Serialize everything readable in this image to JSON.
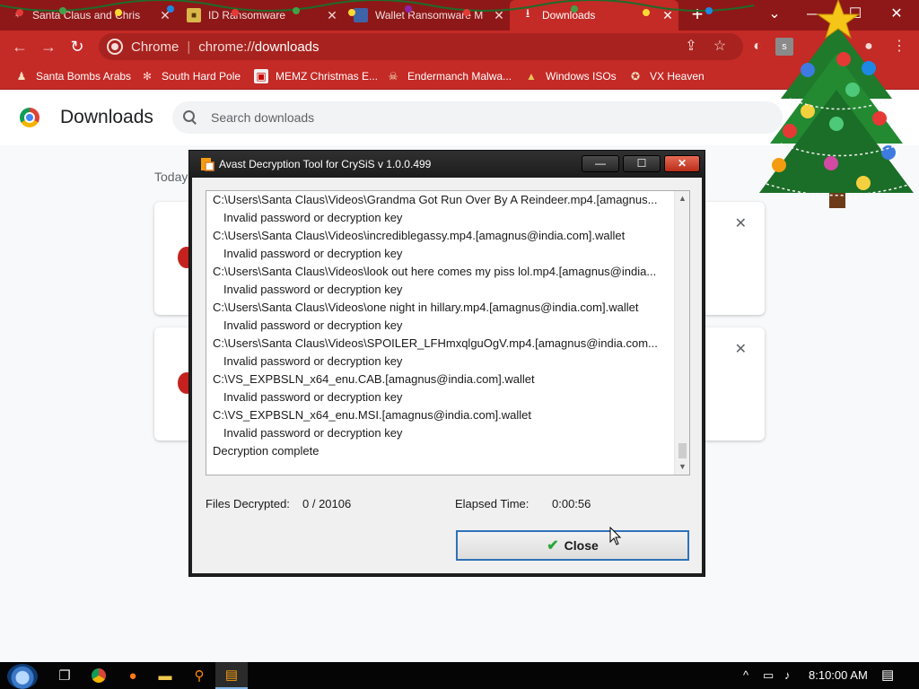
{
  "browser": {
    "tabs": [
      {
        "title": "Santa Claus and Chris",
        "favicon": "santa-icon",
        "active": false
      },
      {
        "title": "ID Ransomware",
        "favicon": "lock-icon",
        "active": false
      },
      {
        "title": "Wallet Ransomware M",
        "favicon": "window-icon",
        "active": false
      },
      {
        "title": "Downloads",
        "favicon": "download-icon",
        "active": true
      }
    ],
    "new_tab_label": "+",
    "omnibox": {
      "chip": "Chrome",
      "url_scheme": "chrome://",
      "url_path": "downloads"
    },
    "bookmarks": [
      {
        "label": "Santa Bombs Arabs",
        "icon": "santa-icon"
      },
      {
        "label": "South Hard Pole",
        "icon": "snowflake-icon"
      },
      {
        "label": "MEMZ Christmas E...",
        "icon": "window-icon"
      },
      {
        "label": "Endermanch Malwa...",
        "icon": "skull-icon"
      },
      {
        "label": "Windows ISOs",
        "icon": "tree-icon"
      },
      {
        "label": "VX Heaven",
        "icon": "wolf-icon"
      }
    ]
  },
  "downloads_page": {
    "title": "Downloads",
    "search_placeholder": "Search downloads",
    "section_label": "Today",
    "remove_glyph": "✕"
  },
  "dialog": {
    "title": "Avast Decryption Tool for CrySiS v 1.0.0.499",
    "log_lines": [
      {
        "text": "C:\\Users\\Santa Claus\\Videos\\Grandma Got Run Over By A Reindeer.mp4.[amagnus...",
        "kind": "file"
      },
      {
        "text": "Invalid password or decryption key",
        "kind": "err"
      },
      {
        "text": "C:\\Users\\Santa Claus\\Videos\\incrediblegassy.mp4.[amagnus@india.com].wallet",
        "kind": "file"
      },
      {
        "text": "Invalid password or decryption key",
        "kind": "err"
      },
      {
        "text": "C:\\Users\\Santa Claus\\Videos\\look out here comes my piss lol.mp4.[amagnus@india...",
        "kind": "file"
      },
      {
        "text": "Invalid password or decryption key",
        "kind": "err"
      },
      {
        "text": "C:\\Users\\Santa Claus\\Videos\\one night in hillary.mp4.[amagnus@india.com].wallet",
        "kind": "file"
      },
      {
        "text": "Invalid password or decryption key",
        "kind": "err"
      },
      {
        "text": "C:\\Users\\Santa Claus\\Videos\\SPOILER_LFHmxqlguOgV.mp4.[amagnus@india.com...",
        "kind": "file"
      },
      {
        "text": "Invalid password or decryption key",
        "kind": "err"
      },
      {
        "text": "C:\\VS_EXPBSLN_x64_enu.CAB.[amagnus@india.com].wallet",
        "kind": "file"
      },
      {
        "text": "Invalid password or decryption key",
        "kind": "err"
      },
      {
        "text": "C:\\VS_EXPBSLN_x64_enu.MSI.[amagnus@india.com].wallet",
        "kind": "file"
      },
      {
        "text": "Invalid password or decryption key",
        "kind": "err"
      },
      {
        "text": "Decryption complete",
        "kind": "status"
      }
    ],
    "files_decrypted_label": "Files Decrypted:",
    "files_decrypted_value": "0 / 20106",
    "elapsed_label": "Elapsed Time:",
    "elapsed_value": "0:00:56",
    "close_label": "Close",
    "min_glyph": "—",
    "max_glyph": "☐",
    "close_glyph": "✕"
  },
  "taskbar": {
    "clock": "8:10:00 AM",
    "items": [
      "start-orb-icon",
      "task-view-icon",
      "chrome-icon",
      "firefox-icon",
      "file-explorer-icon",
      "search-tool-icon",
      "avast-tool-icon"
    ]
  },
  "colors": {
    "tabstrip": "#8e1818",
    "toolbar": "#c42a26",
    "dialog_titlebar": "#262626",
    "close_button_border": "#2f72b8"
  }
}
